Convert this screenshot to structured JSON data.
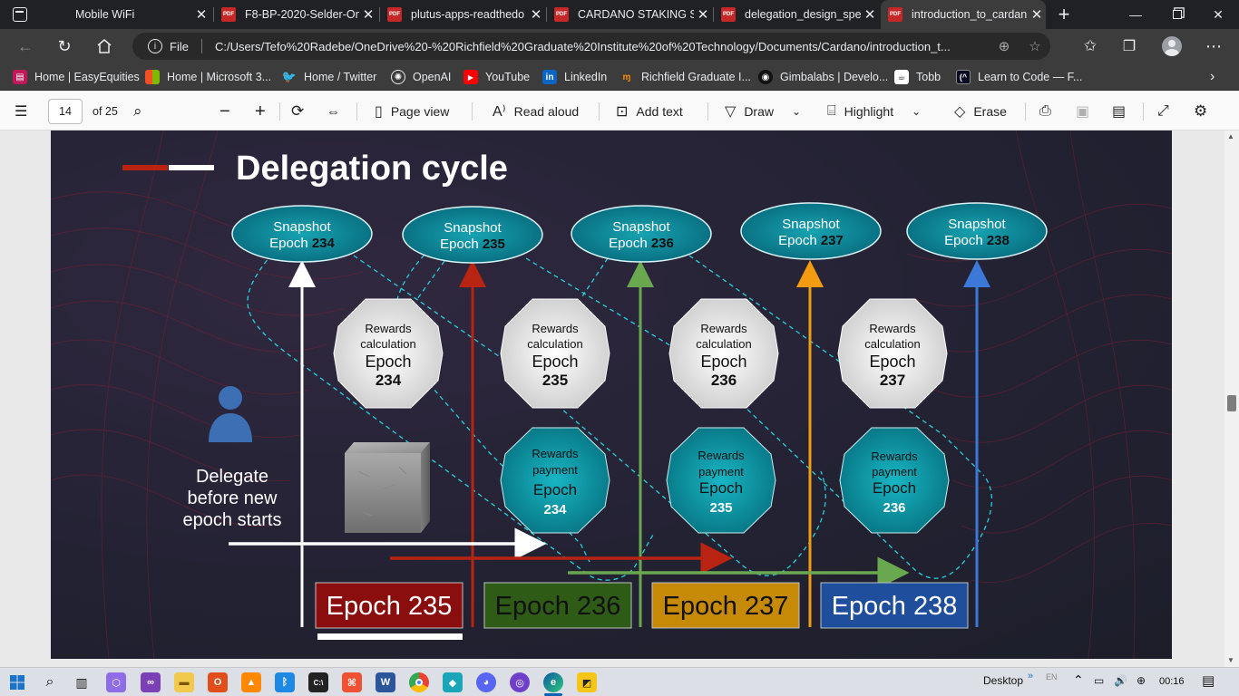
{
  "tabs": [
    {
      "title": "Mobile WiFi",
      "icon": "window-icon",
      "active": false
    },
    {
      "title": "F8-BP-2020-Selder-On",
      "icon": "pdf-icon",
      "active": false
    },
    {
      "title": "plutus-apps-readthedo",
      "icon": "pdf-icon",
      "active": false
    },
    {
      "title": "CARDANO STAKING S",
      "icon": "pdf-icon",
      "active": false
    },
    {
      "title": "delegation_design_spe",
      "icon": "pdf-icon",
      "active": false
    },
    {
      "title": "introduction_to_cardan",
      "icon": "pdf-icon",
      "active": true
    }
  ],
  "pdf_badge": "PDF",
  "address": {
    "scheme_label": "File",
    "url": "C:/Users/Tefo%20Radebe/OneDrive%20-%20Richfield%20Graduate%20Institute%20of%20Technology/Documents/Cardano/introduction_t..."
  },
  "bookmarks": [
    {
      "label": "Home | EasyEquities",
      "icon": "easyequities-icon",
      "color": "#c2185b"
    },
    {
      "label": "Home | Microsoft 3...",
      "icon": "microsoft-icon",
      "color": "#f25022"
    },
    {
      "label": "Home / Twitter",
      "icon": "twitter-icon",
      "color": "#1d9bf0"
    },
    {
      "label": "OpenAI",
      "icon": "openai-icon",
      "color": "#3c3c3c"
    },
    {
      "label": "YouTube",
      "icon": "youtube-icon",
      "color": "#ff0000"
    },
    {
      "label": "LinkedIn",
      "icon": "linkedin-icon",
      "color": "#0a66c2"
    },
    {
      "label": "Richfield Graduate I...",
      "icon": "richfield-icon",
      "color": "#e65100"
    },
    {
      "label": "Gimbalabs | Develo...",
      "icon": "gimbalabs-icon",
      "color": "#111111"
    },
    {
      "label": "Tobb",
      "icon": "tobb-icon",
      "color": "#ffffff"
    },
    {
      "label": "Learn to Code — F...",
      "icon": "freecodecamp-icon",
      "color": "#0a0a23"
    }
  ],
  "pdf_toolbar": {
    "page_number": "14",
    "page_total": "of 25",
    "page_view": "Page view",
    "read_aloud": "Read aloud",
    "add_text": "Add text",
    "draw": "Draw",
    "highlight": "Highlight",
    "erase": "Erase"
  },
  "slide": {
    "title": "Delegation cycle",
    "delegate_text": [
      "Delegate",
      "before new",
      "epoch starts"
    ],
    "snapshot_label": "Snapshot",
    "epoch_label": "Epoch",
    "snapshots": [
      {
        "label": "Snapshot",
        "epoch": "234"
      },
      {
        "label": "Snapshot",
        "epoch": "235"
      },
      {
        "label": "Snapshot",
        "epoch": "236"
      },
      {
        "label": "Snapshot",
        "epoch": "237"
      },
      {
        "label": "Snapshot",
        "epoch": "238"
      }
    ],
    "rewards_calc": [
      {
        "line1": "Rewards",
        "line2": "calculation",
        "line3": "Epoch",
        "epoch": "234"
      },
      {
        "line1": "Rewards",
        "line2": "calculation",
        "line3": "Epoch",
        "epoch": "235"
      },
      {
        "line1": "Rewards",
        "line2": "calculation",
        "line3": "Epoch",
        "epoch": "236"
      },
      {
        "line1": "Rewards",
        "line2": "calculation",
        "line3": "Epoch",
        "epoch": "237"
      }
    ],
    "rewards_pay": [
      {
        "line1": "Rewards",
        "line2": "payment",
        "line3": "Epoch",
        "epoch": "234"
      },
      {
        "line1": "Rewards",
        "line2": "payment",
        "line3": "Epoch",
        "epoch": "235"
      },
      {
        "line1": "Rewards",
        "line2": "payment",
        "line3": "Epoch",
        "epoch": "236"
      }
    ],
    "epoch_boxes": [
      {
        "label": "Epoch 235",
        "color": "#8b0e0e"
      },
      {
        "label": "Epoch 236",
        "color": "#2e5b16"
      },
      {
        "label": "Epoch 237",
        "color": "#c68a06"
      },
      {
        "label": "Epoch 238",
        "color": "#1f4f9c"
      }
    ],
    "colors": {
      "teal": "#0aa8b8",
      "red": "#b82312",
      "green": "#6aa84f",
      "orange": "#f39c12",
      "blue": "#3c78d8",
      "white": "#ffffff"
    }
  },
  "taskbar": {
    "desktop": "Desktop",
    "lang": "EN",
    "time": "00:16"
  }
}
